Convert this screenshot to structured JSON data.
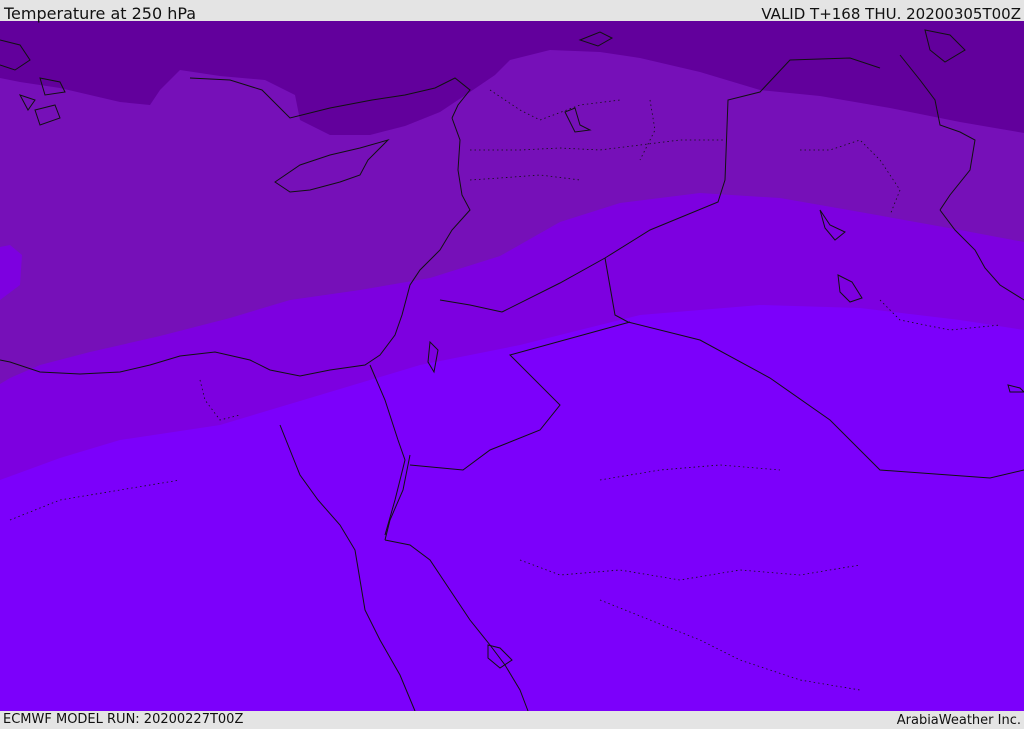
{
  "header": {
    "title": "Temperature at 250 hPa",
    "valid": "VALID T+168 THU. 20200305T00Z"
  },
  "footer": {
    "model_run": "ECMWF MODEL RUN: 20200227T00Z",
    "credit": "ArabiaWeather Inc."
  },
  "map": {
    "colors": {
      "coldest_band": "#62009c",
      "cold_band": "#7610b8",
      "mid_band": "#7d00e0",
      "warm_band": "#7c00fb",
      "coastline": "#111111"
    }
  }
}
